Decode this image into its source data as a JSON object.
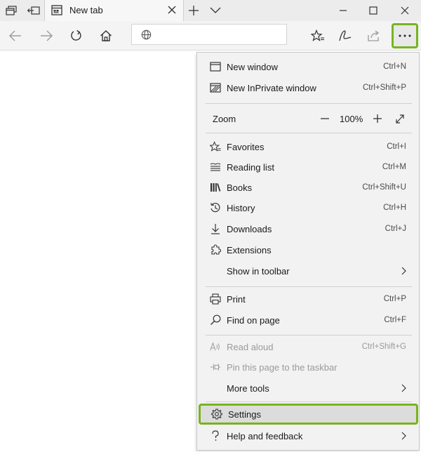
{
  "titlebar": {
    "tab": {
      "title": "New tab",
      "favicon": "newtab-page-icon"
    },
    "buttons": [
      "tab-preview-icon",
      "set-aside-tabs-icon",
      "new-tab-icon",
      "tab-list-chevron-icon"
    ],
    "window_controls": [
      "minimize-icon",
      "maximize-icon",
      "close-icon"
    ]
  },
  "navbar": {
    "buttons": [
      "back-icon",
      "forward-icon",
      "refresh-icon",
      "home-icon"
    ],
    "address": {
      "value": "",
      "placeholder": "",
      "icon": "globe-icon"
    },
    "right_buttons": [
      "favorites-star-icon",
      "pen-notes-icon",
      "share-icon",
      "more-ellipsis-icon"
    ],
    "highlight_color": "#78b41e"
  },
  "menu": {
    "items_top": [
      {
        "label": "New window",
        "shortcut": "Ctrl+N",
        "icon": "window-icon"
      },
      {
        "label": "New InPrivate window",
        "shortcut": "Ctrl+Shift+P",
        "icon": "inprivate-icon"
      }
    ],
    "zoom": {
      "label": "Zoom",
      "value": "100%",
      "icons": [
        "zoom-out-icon",
        "zoom-in-icon",
        "fullscreen-icon"
      ]
    },
    "items_mid": [
      {
        "label": "Favorites",
        "shortcut": "Ctrl+I",
        "icon": "favorites-icon"
      },
      {
        "label": "Reading list",
        "shortcut": "Ctrl+M",
        "icon": "reading-list-icon"
      },
      {
        "label": "Books",
        "shortcut": "Ctrl+Shift+U",
        "icon": "books-icon"
      },
      {
        "label": "History",
        "shortcut": "Ctrl+H",
        "icon": "history-icon"
      },
      {
        "label": "Downloads",
        "shortcut": "Ctrl+J",
        "icon": "download-icon"
      },
      {
        "label": "Extensions",
        "shortcut": "",
        "icon": "extensions-icon"
      },
      {
        "label": "Show in toolbar",
        "shortcut": "",
        "icon": ""
      }
    ],
    "items_page": [
      {
        "label": "Print",
        "shortcut": "Ctrl+P",
        "icon": "print-icon"
      },
      {
        "label": "Find on page",
        "shortcut": "Ctrl+F",
        "icon": "search-icon"
      }
    ],
    "items_tools": [
      {
        "label": "Read aloud",
        "shortcut": "Ctrl+Shift+G",
        "icon": "read-aloud-icon",
        "disabled": true
      },
      {
        "label": "Pin this page to the taskbar",
        "shortcut": "",
        "icon": "pin-icon",
        "disabled": true
      },
      {
        "label": "More tools",
        "shortcut": "",
        "icon": ""
      }
    ],
    "items_bottom": [
      {
        "label": "Settings",
        "shortcut": "",
        "icon": "gear-icon",
        "highlighted": true
      },
      {
        "label": "Help and feedback",
        "shortcut": "",
        "icon": "help-icon"
      }
    ]
  }
}
